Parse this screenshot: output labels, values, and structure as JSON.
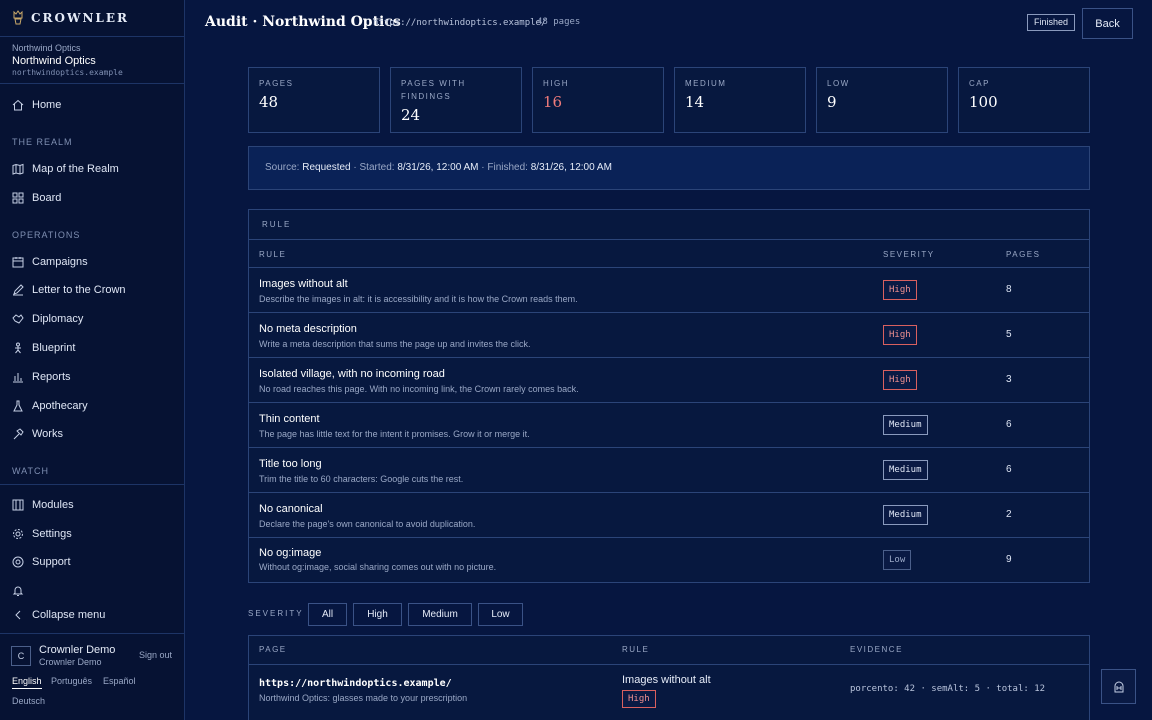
{
  "brand": {
    "name": "CROWNLER"
  },
  "org": {
    "label": "Northwind Optics",
    "name": "Northwind Optics",
    "domain": "northwindoptics.example"
  },
  "nav": {
    "home": "Home",
    "section_realm": "THE REALM",
    "map": "Map of the Realm",
    "board": "Board",
    "section_operations": "OPERATIONS",
    "campaigns": "Campaigns",
    "letter": "Letter to the Crown",
    "diplomacy": "Diplomacy",
    "blueprint": "Blueprint",
    "reports": "Reports",
    "apothecary": "Apothecary",
    "works": "Works",
    "section_watch": "WATCH",
    "modules": "Modules",
    "settings": "Settings",
    "support": "Support",
    "collapse": "Collapse menu"
  },
  "user": {
    "initial": "C",
    "name": "Crownler Demo",
    "sub": "Crownler Demo",
    "signout": "Sign out"
  },
  "languages": [
    "English",
    "Português",
    "Español",
    "Deutsch"
  ],
  "header": {
    "title": "Audit · Northwind Optics",
    "url": "https://northwindoptics.example/",
    "pages": "48 pages",
    "status": "Finished",
    "back": "Back"
  },
  "stats": [
    {
      "label": "PAGES",
      "value": "48"
    },
    {
      "label": "PAGES WITH FINDINGS",
      "value": "24"
    },
    {
      "label": "HIGH",
      "value": "16"
    },
    {
      "label": "MEDIUM",
      "value": "14"
    },
    {
      "label": "LOW",
      "value": "9"
    },
    {
      "label": "CAP",
      "value": "100"
    }
  ],
  "source": {
    "prefix": "Source: ",
    "source": "Requested",
    "started_label": " · Started: ",
    "started": "8/31/26, 12:00 AM",
    "finished_label": " · Finished: ",
    "finished": "8/31/26, 12:00 AM"
  },
  "rules": {
    "title": "RULE",
    "columns": [
      "RULE",
      "SEVERITY",
      "PAGES"
    ],
    "rows": [
      {
        "name": "Images without alt",
        "desc": "Describe the images in alt: it is accessibility and it is how the Crown reads them.",
        "severity": "High",
        "pages": "8"
      },
      {
        "name": "No meta description",
        "desc": "Write a meta description that sums the page up and invites the click.",
        "severity": "High",
        "pages": "5"
      },
      {
        "name": "Isolated village, with no incoming road",
        "desc": "No road reaches this page. With no incoming link, the Crown rarely comes back.",
        "severity": "High",
        "pages": "3"
      },
      {
        "name": "Thin content",
        "desc": "The page has little text for the intent it promises. Grow it or merge it.",
        "severity": "Medium",
        "pages": "6"
      },
      {
        "name": "Title too long",
        "desc": "Trim the title to 60 characters: Google cuts the rest.",
        "severity": "Medium",
        "pages": "6"
      },
      {
        "name": "No canonical",
        "desc": "Declare the page's own canonical to avoid duplication.",
        "severity": "Medium",
        "pages": "2"
      },
      {
        "name": "No og:image",
        "desc": "Without og:image, social sharing comes out with no picture.",
        "severity": "Low",
        "pages": "9"
      }
    ]
  },
  "filter": {
    "label": "SEVERITY",
    "options": [
      "All",
      "High",
      "Medium",
      "Low"
    ]
  },
  "pages_table": {
    "columns": [
      "PAGE",
      "RULE",
      "EVIDENCE"
    ],
    "rows": [
      {
        "url": "https://northwindoptics.example/",
        "title": "Northwind Optics: glasses made to your prescription",
        "rule": "Images without alt",
        "severity": "High",
        "evidence": "porcento: 42 · semAlt: 5 · total: 12"
      }
    ]
  },
  "colors": {
    "background": "#061640",
    "sidebar": "#061233",
    "border": "#2b4478",
    "high": "#ef7b7b",
    "accent_panel": "#0a2257"
  }
}
